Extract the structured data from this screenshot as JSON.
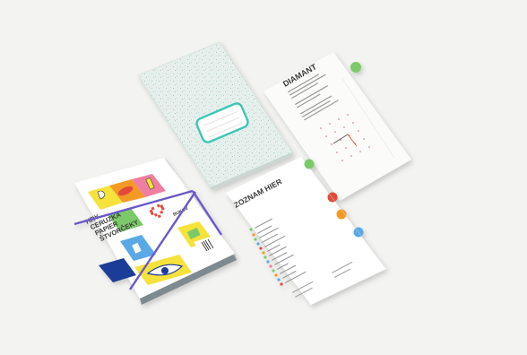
{
  "cover": {
    "title_lines": [
      "HRY",
      "CERUZKA",
      "PAPIER",
      "ŠTVORČEKY"
    ],
    "brand": "BUKOV"
  },
  "list_card": {
    "title": "ZOZNAM HIER",
    "items": [
      "ÚVOD",
      "SLOVNÍČEK",
      "OTVORENIE 1",
      "OTVORENIE 2",
      "PÍSMENKOVÉ OBRAZY",
      "CESTA",
      "KRÍŽOVKY",
      "HLADANIE",
      "PRESÚVANIE PÍSMEN",
      "DOMINO",
      "DIAMANT",
      "ČÍSELNÉ",
      "HADY",
      "GEOMETRICKÉ",
      "RIEŠENIA",
      "BONUS",
      "PRAVIDLÁ HIER, ZÁVER A INÉ"
    ],
    "labels": [
      "ÚVOD",
      "POČET HRÁČOV",
      "ZLOŽITOSŤ",
      "TYP HRY"
    ]
  },
  "diamond_card": {
    "title": "DIAMANT"
  },
  "colors": {
    "background": "#f3f3f1",
    "notebook": "#dfe9e5",
    "label_border": "#3cc6b5",
    "strap": "#6a59c9",
    "green": "#7cc96b",
    "red": "#e34a3b",
    "orange": "#f39a25",
    "blue": "#5aa8e6",
    "yellow": "#f5e23a",
    "pink": "#ef7fa2"
  }
}
